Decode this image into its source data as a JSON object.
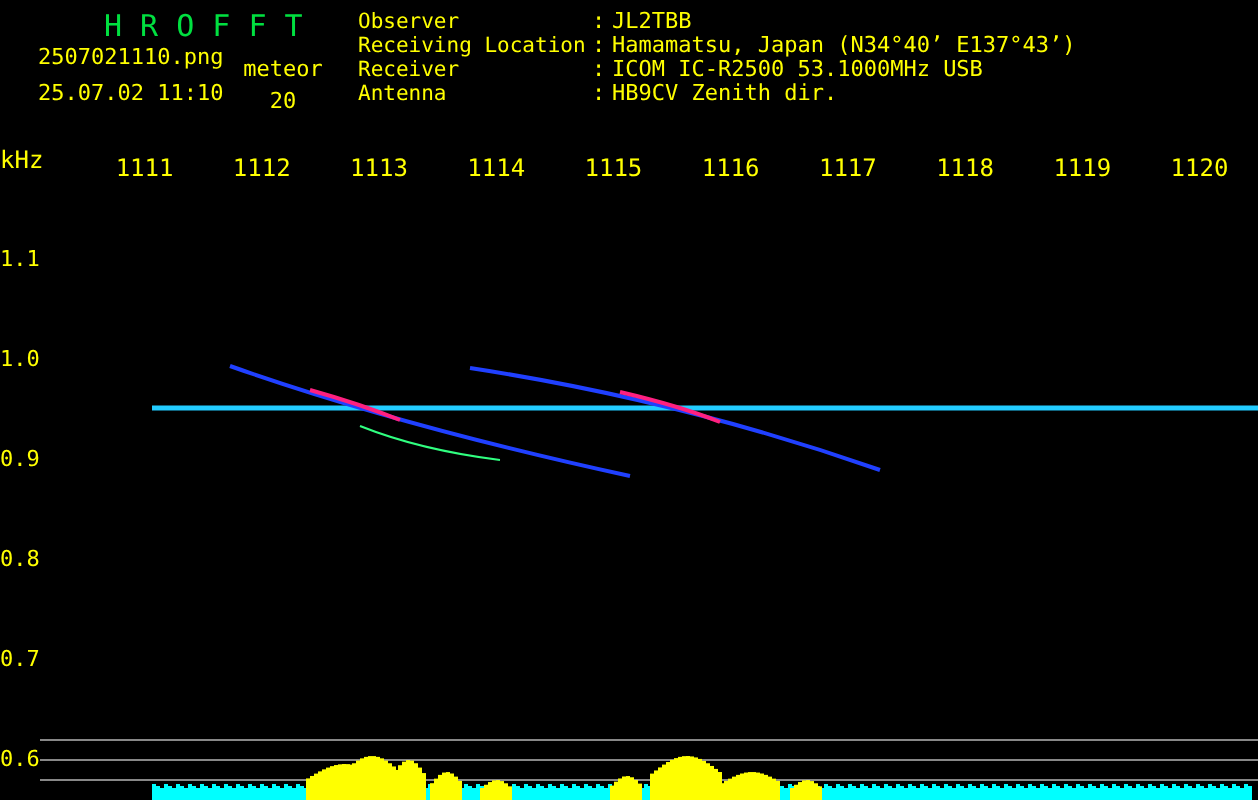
{
  "app_title": "H R O F F T",
  "file_name": "2507021110.png",
  "timestamp": "25.07.02 11:10",
  "meteor": {
    "label": "meteor",
    "count": "20"
  },
  "info": [
    {
      "label": "Observer",
      "separator": ":",
      "value": "JL2TBB"
    },
    {
      "label": "Receiving Location",
      "separator": ":",
      "value": "Hamamatsu, Japan (N34°40’ E137°43’)"
    },
    {
      "label": "Receiver",
      "separator": ":",
      "value": "ICOM IC-R2500 53.1000MHz USB"
    },
    {
      "label": "Antenna",
      "separator": ":",
      "value": "HB9CV Zenith dir."
    }
  ],
  "x_axis": {
    "unit": "kHz",
    "labels": [
      "1111",
      "1112",
      "1113",
      "1114",
      "1115",
      "1116",
      "1117",
      "1118",
      "1119",
      "1120"
    ]
  },
  "y_axis": {
    "labels": [
      "1.1",
      "1.0",
      "0.9",
      "0.8",
      "0.7",
      "0.6"
    ]
  }
}
